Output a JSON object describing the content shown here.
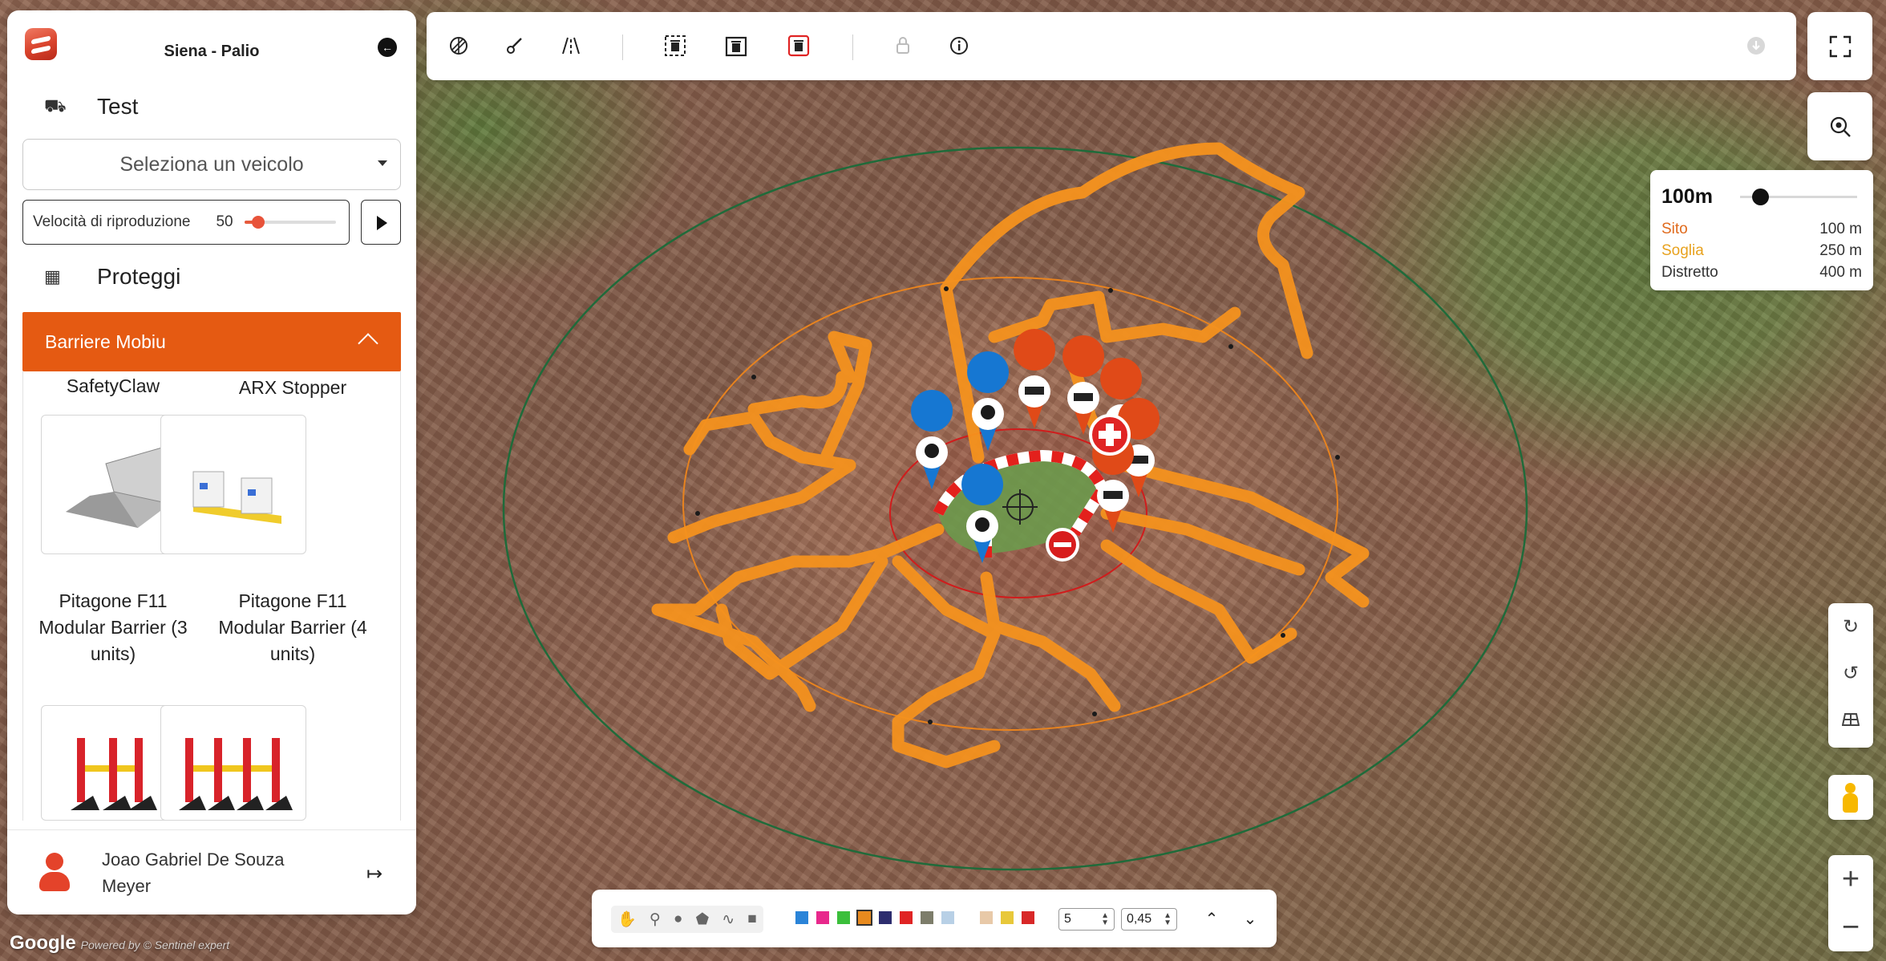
{
  "app": {
    "title": "Siena - Palio"
  },
  "sidebar": {
    "vehicle_section": {
      "label": "Test",
      "icon": "truck-icon"
    },
    "vehicle_select": {
      "value": "Seleziona un veicolo"
    },
    "playback": {
      "label": "Velocità di riproduzione",
      "value": "50",
      "level": 0.15
    },
    "protect_section": {
      "label": "Proteggi",
      "icon": "barrier-icon"
    },
    "accordion": {
      "label": "Barriere Mobiu"
    },
    "catalog": [
      {
        "name": "SafetyClaw"
      },
      {
        "name": "ARX Stopper"
      },
      {
        "name": "Pitagone F11 Modular Barrier (3 units)"
      },
      {
        "name": "Pitagone F11 Modular Barrier (4 units)"
      }
    ],
    "user": {
      "name": "Joao Gabriel De Souza Meyer"
    }
  },
  "toolbar": {
    "icons": [
      "layers-icon",
      "brush-icon",
      "road-icon",
      "select-area-icon",
      "trash-area-icon",
      "delete-icon",
      "lock-icon",
      "info-icon",
      "download-icon"
    ]
  },
  "distance": {
    "current": "100m",
    "level": 0.17,
    "rows": [
      {
        "label": "Sito",
        "value": "100 m",
        "color": "#e06a1c"
      },
      {
        "label": "Soglia",
        "value": "250 m",
        "color": "#e8a21e"
      },
      {
        "label": "Distretto",
        "value": "400 m",
        "color": "#333333"
      }
    ]
  },
  "bottom_bar": {
    "tools": [
      "hand-icon",
      "pin-icon",
      "circle-icon",
      "polygon-icon",
      "line-icon",
      "square-icon"
    ],
    "colors": [
      "#2a84d8",
      "#e8288c",
      "#3bbf3b",
      "#e88a1e",
      "#2d2d6e",
      "#e02424",
      "#7d7d6a",
      "#b8d0e6",
      "#e8c9a8",
      "#e8c83a",
      "#d82828"
    ],
    "selected_color": "#e88a1e",
    "width_value": "5",
    "opacity_value": "0,45"
  },
  "attribution": {
    "brand": "Google",
    "credit": "Powered by © Sentinel expert"
  }
}
